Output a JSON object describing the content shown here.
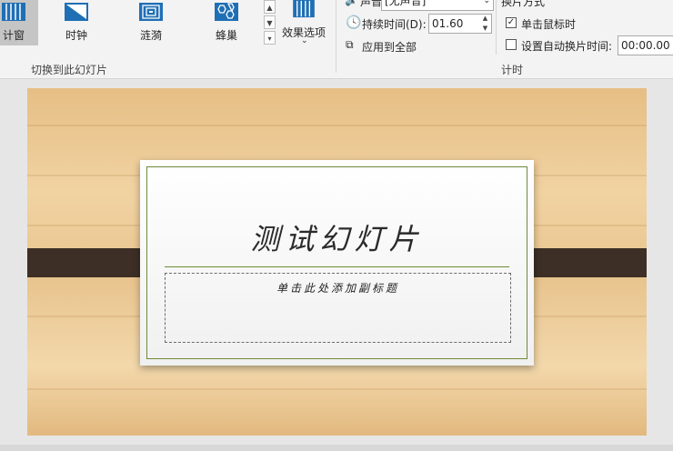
{
  "ribbon": {
    "transitions": [
      {
        "id": "window",
        "label": "计窗",
        "icon": "window-transition-icon",
        "selected": true
      },
      {
        "id": "clock",
        "label": "时钟",
        "icon": "clock-transition-icon",
        "selected": false
      },
      {
        "id": "ripple",
        "label": "涟漪",
        "icon": "ripple-transition-icon",
        "selected": false
      },
      {
        "id": "honeycomb",
        "label": "蜂巢",
        "icon": "honeycomb-transition-icon",
        "selected": false
      }
    ],
    "effect_options_label": "效果选项",
    "group_transition_label": "切换到此幻灯片",
    "sound_label": "声音:",
    "sound_value": "[无声音]",
    "duration_label": "持续时间(D):",
    "duration_value": "01.60",
    "apply_all_label": "应用到全部",
    "advance_header": "换片方式",
    "on_click_label": "单击鼠标时",
    "on_click_checked": true,
    "auto_after_label": "设置自动换片时间:",
    "auto_after_value": "00:00.00",
    "auto_after_checked": false,
    "group_timing_label": "计时"
  },
  "slide": {
    "title": "测试幻灯片",
    "subtitle_placeholder": "单击此处添加副标题"
  },
  "colors": {
    "accent_line": "#6f8a3a",
    "band": "#3d2f25"
  }
}
